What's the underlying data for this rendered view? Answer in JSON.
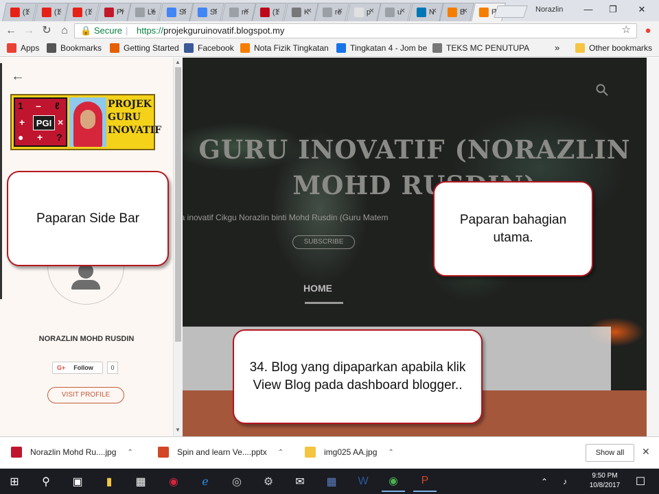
{
  "browser": {
    "tabs": [
      {
        "label": "(1",
        "fav_color": "#e62117"
      },
      {
        "label": "(1",
        "fav_color": "#e62117"
      },
      {
        "label": "(1",
        "fav_color": "#e62117"
      },
      {
        "label": "Pr",
        "fav_color": "#c2182b"
      },
      {
        "label": "Le",
        "fav_color": "#9aa0a6"
      },
      {
        "label": "Sl",
        "fav_color": "#4285f4"
      },
      {
        "label": "Sl",
        "fav_color": "#4285f4"
      },
      {
        "label": "m",
        "fav_color": "#9aa0a6"
      },
      {
        "label": "(1",
        "fav_color": "#bd081c"
      },
      {
        "label": "K",
        "fav_color": "#777777"
      },
      {
        "label": "re",
        "fav_color": "#9aa0a6"
      },
      {
        "label": "p",
        "fav_color": "#e0e0e0"
      },
      {
        "label": "u",
        "fav_color": "#9aa0a6"
      },
      {
        "label": "N",
        "fav_color": "#0077b5"
      },
      {
        "label": "B",
        "fav_color": "#f57d00"
      },
      {
        "label": "Pl",
        "fav_color": "#f57d00"
      }
    ],
    "profile_name": "Norazlin",
    "omnibox": {
      "secure_label": "Secure",
      "url_scheme": "https://",
      "url_host": "projekguruinovatif.blogspot.my"
    },
    "bookmarks": [
      {
        "label": "Apps",
        "icon": "apps-grid-icon",
        "color": "#e94235"
      },
      {
        "label": "Bookmarks",
        "icon": "star-icon",
        "color": "#555555"
      },
      {
        "label": "Getting Started",
        "icon": "firefox-icon",
        "color": "#e66000"
      },
      {
        "label": "Facebook",
        "icon": "facebook-icon",
        "color": "#3b5998"
      },
      {
        "label": "Nota Fizik Tingkatan",
        "icon": "blogger-icon",
        "color": "#f57d00"
      },
      {
        "label": "Tingkatan 4 - Jom be",
        "icon": "page-icon",
        "color": "#1a73e8"
      },
      {
        "label": "TEKS MC PENUTUPA",
        "icon": "page-icon",
        "color": "#777777"
      },
      {
        "label": "Other bookmarks",
        "icon": "folder-icon",
        "color": "#f4c542"
      }
    ],
    "bookmarks_overflow": "»"
  },
  "sidebar": {
    "logo": {
      "symbols": [
        "1",
        "–",
        "ℓ",
        "+",
        "×",
        "●",
        "+",
        "?"
      ],
      "center": "PGI",
      "text_lines": [
        "PROJEK",
        "GURU",
        "INOVATIF"
      ]
    },
    "profile_name": "NORAZLIN MOHD RUSDIN",
    "follow_label": "Follow",
    "follow_count": "0",
    "visit_label": "VISIT PROFILE"
  },
  "main": {
    "blog_title": "GURU INOVATIF (NORAZLIN MOHD RUSDIN)",
    "description": "rja inovatif Cikgu Norazlin binti Mohd Rusdin (Guru Matem",
    "subscribe_label": "SUBSCRIBE",
    "nav_home": "HOME"
  },
  "callouts": {
    "sidebar": "Paparan Side Bar",
    "main": "Paparan bahagian utama.",
    "caption": "34. Blog yang dipaparkan apabila klik View Blog pada dashboard blogger.."
  },
  "downloads": {
    "items": [
      {
        "name": "Norazlin Mohd Ru....jpg",
        "icon_color": "#c0152f"
      },
      {
        "name": "Spin and learn Ve....pptx",
        "icon_color": "#d24726"
      },
      {
        "name": "img025 AA.jpg",
        "icon_color": "#f4c542"
      }
    ],
    "show_all": "Show all"
  },
  "taskbar": {
    "time": "9:50 PM",
    "date": "10/8/2017"
  },
  "colors": {
    "callout_border": "#b3161f",
    "accent_visit": "#c25a3c",
    "footer_band": "#a5573c"
  }
}
